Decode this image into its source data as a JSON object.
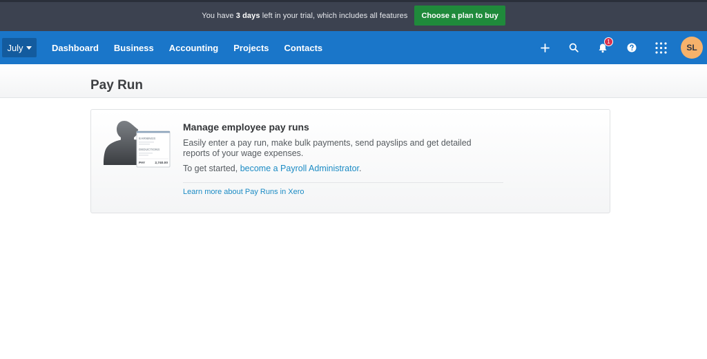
{
  "trial_banner": {
    "text_before": "You have ",
    "days": "3 days",
    "text_after": " left in your trial, which includes all features",
    "cta_label": "Choose a plan to buy"
  },
  "nav": {
    "org_label": "July",
    "links": [
      "Dashboard",
      "Business",
      "Accounting",
      "Projects",
      "Contacts"
    ],
    "icons": [
      "plus-icon",
      "search-icon",
      "bell-icon",
      "help-icon",
      "app-grid-icon"
    ],
    "notification_count": "1",
    "avatar_initials": "SL"
  },
  "page": {
    "title": "Pay Run"
  },
  "card": {
    "heading": "Manage employee pay runs",
    "description": "Easily enter a pay run, make bulk payments, send payslips and get detailed reports of your wage expenses.",
    "start_prefix": "To get started, ",
    "start_link": "become a Payroll Administrator",
    "start_suffix": ".",
    "learn_more": "Learn more about Pay Runs in Xero",
    "illustration": {
      "earnings_label": "EARNINGS",
      "deductions_label": "DEDUCTIONS",
      "pay_label": "PAY",
      "pay_amount": "2,740.00"
    }
  },
  "colors": {
    "trial_bar": "#3c4250",
    "cta_green": "#1f8a3b",
    "nav_blue": "#1a76c9",
    "org_button": "#135b9e",
    "link_blue": "#1b8bc4",
    "avatar": "#f6b26b",
    "badge_red": "#d9304b"
  }
}
